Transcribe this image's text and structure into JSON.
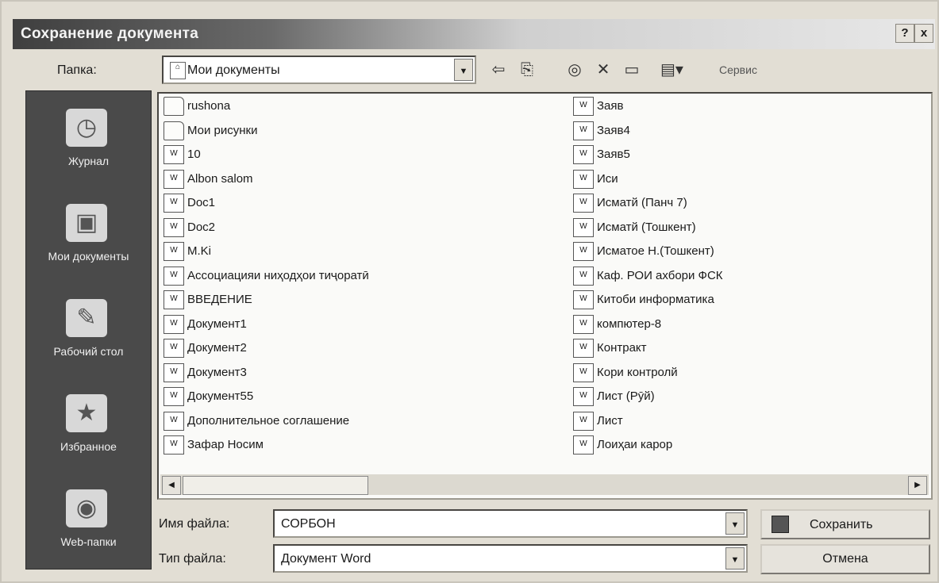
{
  "window": {
    "title": "Сохранение документа",
    "help": "?",
    "close": "x"
  },
  "location": {
    "label": "Папка:",
    "value": "Мои документы"
  },
  "toolbar": {
    "views_label": "Сервис"
  },
  "places": [
    {
      "label": "Журнал",
      "icon": "history-icon"
    },
    {
      "label": "Мои документы",
      "icon": "my-documents-icon"
    },
    {
      "label": "Рабочий стол",
      "icon": "desktop-icon"
    },
    {
      "label": "Избранное",
      "icon": "favorites-icon"
    },
    {
      "label": "Web-папки",
      "icon": "web-folders-icon"
    }
  ],
  "files": [
    {
      "name": "rushona",
      "type": "folder"
    },
    {
      "name": "Мои рисунки",
      "type": "folder"
    },
    {
      "name": "10",
      "type": "doc"
    },
    {
      "name": "Albon salom",
      "type": "doc"
    },
    {
      "name": "Doc1",
      "type": "doc"
    },
    {
      "name": "Doc2",
      "type": "doc"
    },
    {
      "name": "M.Ki",
      "type": "doc"
    },
    {
      "name": "Ассоциацияи ниҳодҳои тиҷоратӣ",
      "type": "doc"
    },
    {
      "name": "ВВЕДЕНИЕ",
      "type": "doc"
    },
    {
      "name": "Документ1",
      "type": "doc"
    },
    {
      "name": "Документ2",
      "type": "doc"
    },
    {
      "name": "Документ3",
      "type": "doc"
    },
    {
      "name": "Документ55",
      "type": "doc"
    },
    {
      "name": "Дополнительное соглашение",
      "type": "doc"
    },
    {
      "name": "Зафар Носим",
      "type": "doc"
    },
    {
      "name": "Заяв",
      "type": "doc"
    },
    {
      "name": "Заяв4",
      "type": "doc"
    },
    {
      "name": "Заяв5",
      "type": "doc"
    },
    {
      "name": "Иси",
      "type": "doc"
    },
    {
      "name": "Исматй (Панч 7)",
      "type": "doc"
    },
    {
      "name": "Исматй (Тошкент)",
      "type": "doc"
    },
    {
      "name": "Исматое Н.(Тошкент)",
      "type": "doc"
    },
    {
      "name": "Каф. РОИ ахбори ФСК",
      "type": "doc"
    },
    {
      "name": "Китоби информатика",
      "type": "doc"
    },
    {
      "name": "компютер-8",
      "type": "doc"
    },
    {
      "name": "Контракт",
      "type": "doc"
    },
    {
      "name": "Кори контролй",
      "type": "doc"
    },
    {
      "name": "Лист (Рӯй)",
      "type": "doc"
    },
    {
      "name": "Лист",
      "type": "doc"
    },
    {
      "name": "Лоиҳаи карор",
      "type": "doc"
    }
  ],
  "filename": {
    "label": "Имя файла:",
    "value": "СОРБОН"
  },
  "filetype": {
    "label": "Тип файла:",
    "value": "Документ Word"
  },
  "buttons": {
    "save": "Сохранить",
    "cancel": "Отмена"
  }
}
